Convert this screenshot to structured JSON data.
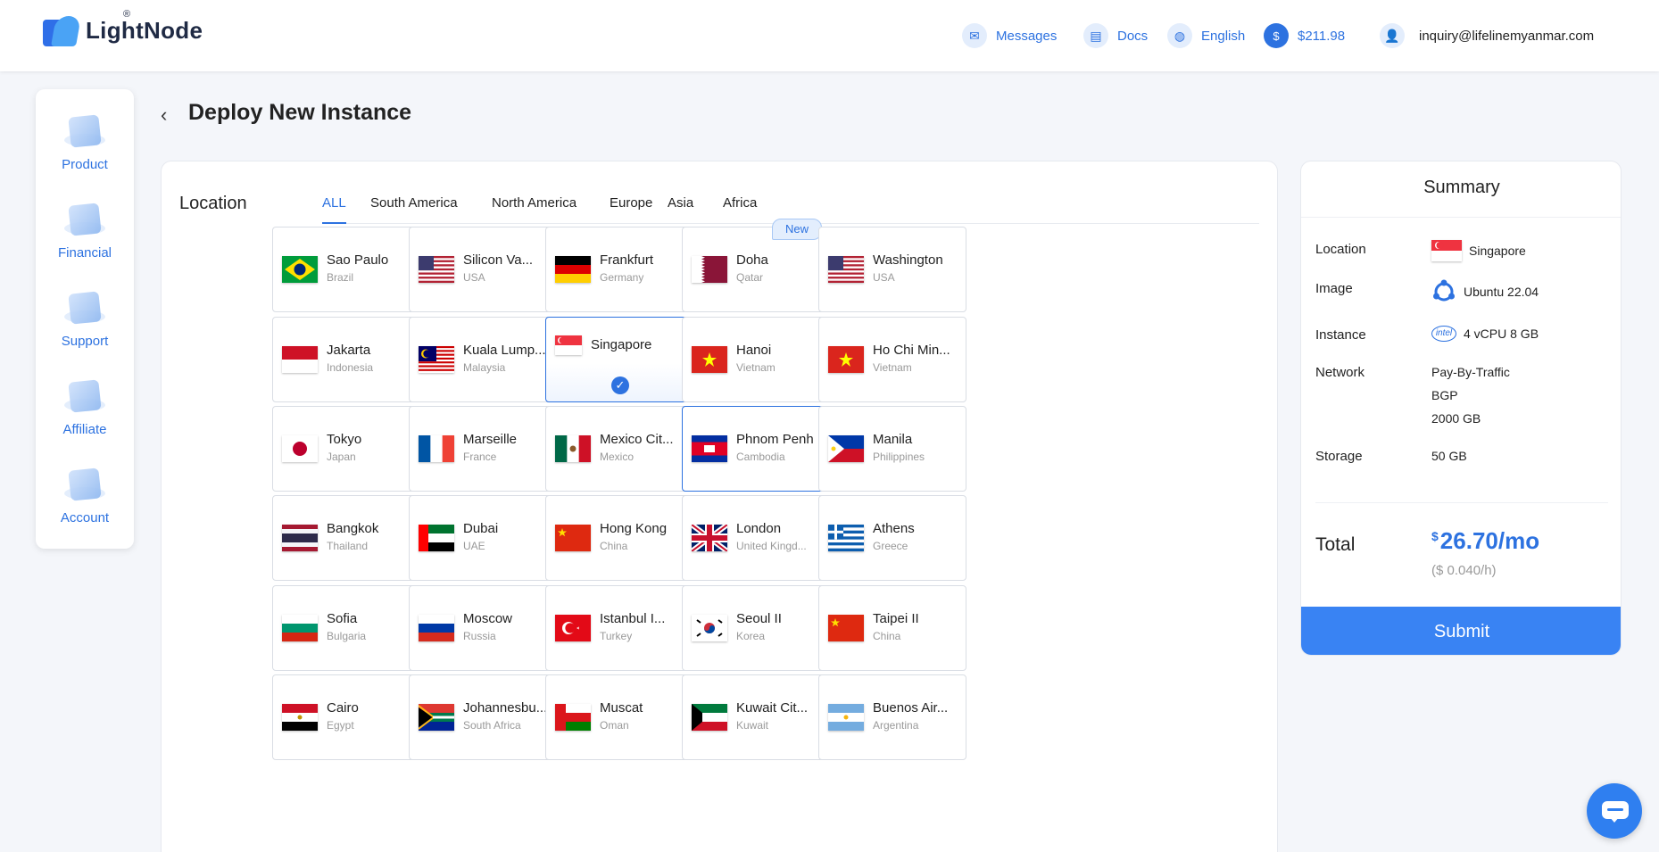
{
  "header": {
    "logo_text": "LightNode",
    "logo_mark": "®",
    "messages_label": "Messages",
    "docs_label": "Docs",
    "language_label": "English",
    "balance": "$211.98",
    "account_email": "inquiry@lifelinemyanmar.com"
  },
  "sidebar": {
    "items": [
      {
        "label": "Product",
        "icon": "product-icon"
      },
      {
        "label": "Financial",
        "icon": "financial-icon"
      },
      {
        "label": "Support",
        "icon": "support-icon"
      },
      {
        "label": "Affiliate",
        "icon": "affiliate-icon"
      },
      {
        "label": "Account",
        "icon": "account-icon"
      }
    ]
  },
  "page": {
    "title": "Deploy New Instance"
  },
  "location": {
    "label": "Location",
    "tabs": [
      "ALL",
      "South America",
      "North America",
      "Europe",
      "Asia",
      "Africa"
    ],
    "active_tab": "ALL",
    "new_badge": "New",
    "selected": "Singapore",
    "cards": [
      {
        "city": "Sao Paulo",
        "country": "Brazil"
      },
      {
        "city": "Silicon Va...",
        "country": "USA"
      },
      {
        "city": "Frankfurt",
        "country": "Germany"
      },
      {
        "city": "Doha",
        "country": "Qatar"
      },
      {
        "city": "Washington",
        "country": "USA"
      },
      {
        "city": "Jakarta",
        "country": "Indonesia"
      },
      {
        "city": "Kuala Lump...",
        "country": "Malaysia"
      },
      {
        "city": "Singapore",
        "country": ""
      },
      {
        "city": "Hanoi",
        "country": "Vietnam"
      },
      {
        "city": "Ho Chi Min...",
        "country": "Vietnam"
      },
      {
        "city": "Tokyo",
        "country": "Japan"
      },
      {
        "city": "Marseille",
        "country": "France"
      },
      {
        "city": "Mexico Cit...",
        "country": "Mexico"
      },
      {
        "city": "Phnom Penh",
        "country": "Cambodia"
      },
      {
        "city": "Manila",
        "country": "Philippines"
      },
      {
        "city": "Bangkok",
        "country": "Thailand"
      },
      {
        "city": "Dubai",
        "country": "UAE"
      },
      {
        "city": "Hong Kong",
        "country": "China"
      },
      {
        "city": "London",
        "country": "United Kingd..."
      },
      {
        "city": "Athens",
        "country": "Greece"
      },
      {
        "city": "Sofia",
        "country": "Bulgaria"
      },
      {
        "city": "Moscow",
        "country": "Russia"
      },
      {
        "city": "Istanbul I...",
        "country": "Turkey"
      },
      {
        "city": "Seoul II",
        "country": "Korea"
      },
      {
        "city": "Taipei II",
        "country": "China"
      },
      {
        "city": "Cairo",
        "country": "Egypt"
      },
      {
        "city": "Johannesbu...",
        "country": "South Africa"
      },
      {
        "city": "Muscat",
        "country": "Oman"
      },
      {
        "city": "Kuwait Cit...",
        "country": "Kuwait"
      },
      {
        "city": "Buenos Air...",
        "country": "Argentina"
      }
    ]
  },
  "summary": {
    "title": "Summary",
    "location_key": "Location",
    "location_val": "Singapore",
    "image_key": "Image",
    "image_val": "Ubuntu 22.04",
    "instance_key": "Instance",
    "instance_badge": "intel",
    "instance_val": "4 vCPU 8 GB",
    "network_key": "Network",
    "network_vals": [
      "Pay-By-Traffic",
      "BGP",
      "2000 GB"
    ],
    "storage_key": "Storage",
    "storage_val": "50 GB",
    "total_label": "Total",
    "currency": "$",
    "total_price": "26.70/mo",
    "hourly": "($ 0.040/h)",
    "submit_label": "Submit"
  },
  "colors": {
    "accent": "#2d72e0",
    "submit": "#3983f3"
  }
}
